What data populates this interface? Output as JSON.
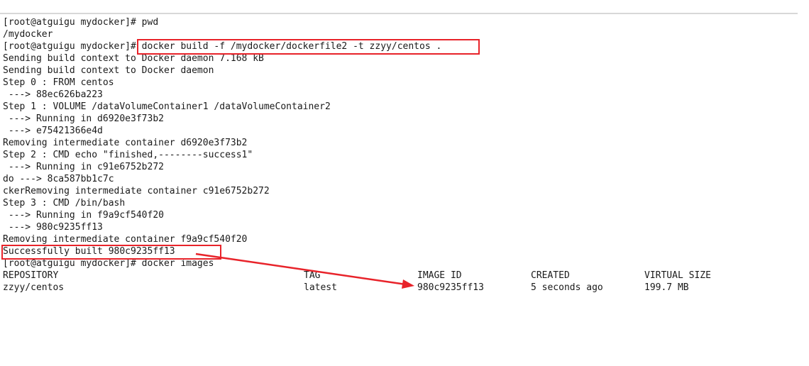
{
  "terminal": {
    "lines": [
      "[root@atguigu mydocker]# pwd",
      "/mydocker",
      "[root@atguigu mydocker]# docker build -f /mydocker/dockerfile2 -t zzyy/centos .",
      "Sending build context to Docker daemon 7.168 kB",
      "Sending build context to Docker daemon",
      "Step 0 : FROM centos",
      " ---> 88ec626ba223",
      "Step 1 : VOLUME /dataVolumeContainer1 /dataVolumeContainer2",
      " ---> Running in d6920e3f73b2",
      " ---> e75421366e4d",
      "Removing intermediate container d6920e3f73b2",
      "Step 2 : CMD echo \"finished,--------success1\"",
      " ---> Running in c91e6752b272",
      "do ---> 8ca587bb1c7c",
      "ckerRemoving intermediate container c91e6752b272",
      "Step 3 : CMD /bin/bash",
      " ---> Running in f9a9cf540f20",
      " ---> 980c9235ff13",
      "Removing intermediate container f9a9cf540f20",
      "Successfully built 980c9235ff13",
      "[root@atguigu mydocker]# docker images"
    ],
    "images_table": {
      "headers": [
        "REPOSITORY",
        "TAG",
        "IMAGE ID",
        "CREATED",
        "VIRTUAL SIZE"
      ],
      "rows": [
        [
          "zzyy/centos",
          "latest",
          "980c9235ff13",
          "5 seconds ago",
          "199.7 MB"
        ]
      ]
    }
  },
  "annotations": {
    "color": "#e8232a",
    "boxes": [
      "build-command",
      "successfully-built"
    ],
    "arrow": "successfully-built-to-image-id"
  }
}
